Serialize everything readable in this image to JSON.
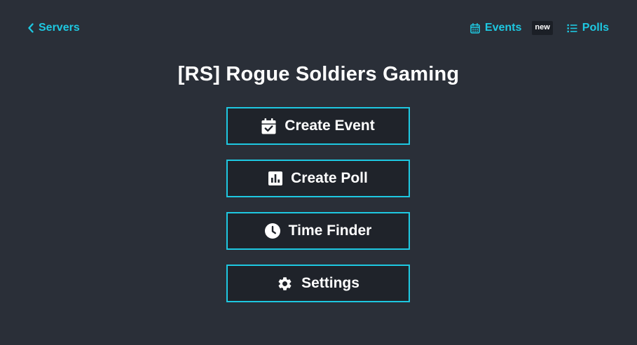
{
  "nav": {
    "back_label": "Servers",
    "events_label": "Events",
    "events_badge": "new",
    "polls_label": "Polls"
  },
  "server": {
    "title": "[RS] Rogue Soldiers Gaming"
  },
  "menu": {
    "items": [
      {
        "label": "Create Event",
        "icon": "calendar-check-icon"
      },
      {
        "label": "Create Poll",
        "icon": "poll-chart-icon"
      },
      {
        "label": "Time Finder",
        "icon": "clock-icon"
      },
      {
        "label": "Settings",
        "icon": "gear-icon"
      }
    ]
  },
  "colors": {
    "background": "#2a2f38",
    "accent": "#1ec8e1",
    "button_bg": "#1f232a",
    "badge_bg": "#1b1f26"
  }
}
